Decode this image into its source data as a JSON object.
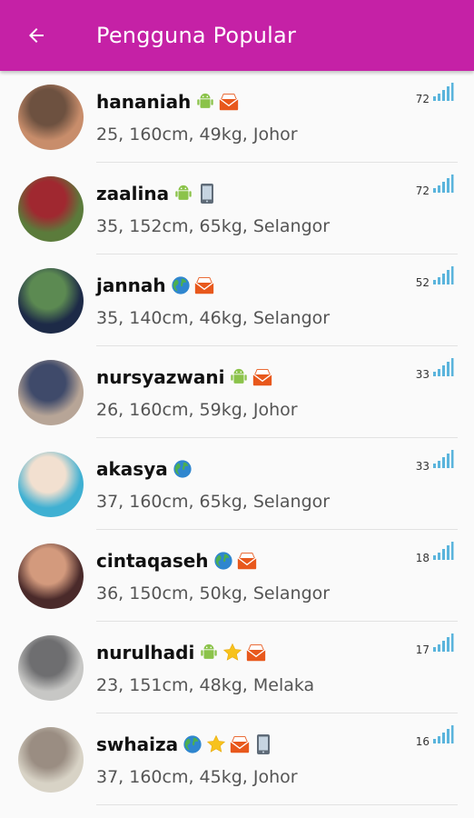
{
  "appbar": {
    "title": "Pengguna Popular"
  },
  "colors": {
    "primary": "#c521a6",
    "signal": "#5ab4dc"
  },
  "users": [
    {
      "name": "hananiah",
      "details": "25, 160cm, 49kg, Johor",
      "score": "72",
      "badges": [
        "android-icon",
        "mail-icon"
      ],
      "avatar": [
        "#c88d6b",
        "#6d5140"
      ]
    },
    {
      "name": "zaalina",
      "details": "35, 152cm, 65kg, Selangor",
      "score": "72",
      "badges": [
        "android-icon",
        "phone-icon"
      ],
      "avatar": [
        "#5b7b3b",
        "#a02830"
      ]
    },
    {
      "name": "jannah",
      "details": "35, 140cm, 46kg, Selangor",
      "score": "52",
      "badges": [
        "globe-icon",
        "mail-icon"
      ],
      "avatar": [
        "#1d2a47",
        "#5c8a52"
      ]
    },
    {
      "name": "nursyazwani",
      "details": "26, 160cm, 59kg, Johor",
      "score": "33",
      "badges": [
        "android-icon",
        "mail-icon"
      ],
      "avatar": [
        "#b7a597",
        "#3f4a6a"
      ]
    },
    {
      "name": "akasya",
      "details": "37, 160cm, 65kg, Selangor",
      "score": "33",
      "badges": [
        "globe-icon"
      ],
      "avatar": [
        "#3fb0d2",
        "#f2e0d0"
      ]
    },
    {
      "name": "cintaqaseh",
      "details": "36, 150cm, 50kg, Selangor",
      "score": "18",
      "badges": [
        "globe-icon",
        "mail-icon"
      ],
      "avatar": [
        "#4a2a2a",
        "#d39a7d"
      ]
    },
    {
      "name": "nurulhadi",
      "details": "23, 151cm, 48kg, Melaka",
      "score": "17",
      "badges": [
        "android-icon",
        "star-icon",
        "mail-icon"
      ],
      "avatar": [
        "#c7c7c5",
        "#6e6e70"
      ]
    },
    {
      "name": "swhaiza",
      "details": "37, 160cm, 45kg, Johor",
      "score": "16",
      "badges": [
        "globe-icon",
        "star-icon",
        "mail-icon",
        "phone-icon"
      ],
      "avatar": [
        "#d8d3c6",
        "#9a8d82"
      ]
    }
  ]
}
